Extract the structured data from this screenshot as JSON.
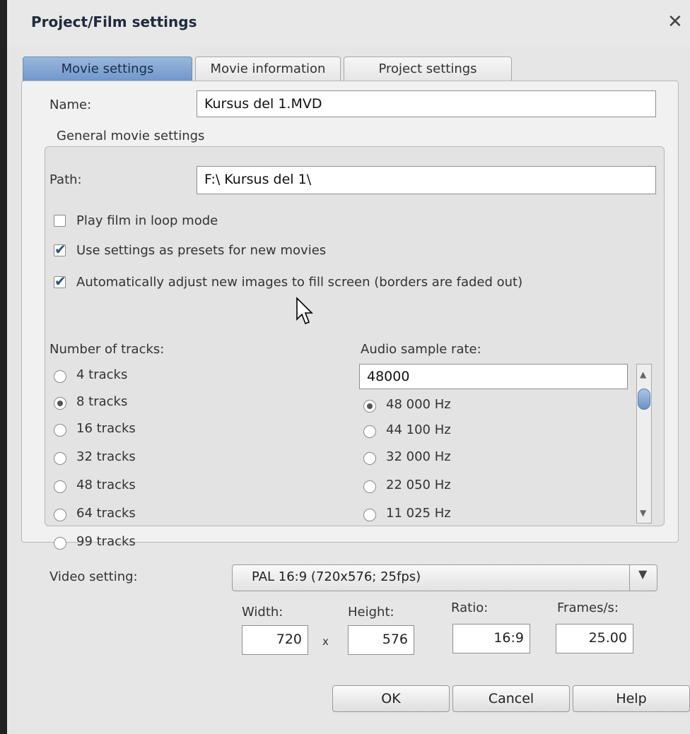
{
  "window": {
    "title": "Project/Film settings"
  },
  "tabs": [
    {
      "label": "Movie settings"
    },
    {
      "label": "Movie information"
    },
    {
      "label": "Project settings"
    }
  ],
  "name": {
    "label": "Name:",
    "value": "Kursus del 1.MVD"
  },
  "general": {
    "heading": "General movie settings",
    "path_label": "Path:",
    "path_value": "F:\\ Kursus del 1\\",
    "options": [
      {
        "label": "Play film in loop mode",
        "checked": false
      },
      {
        "label": "Use settings as presets for new movies",
        "checked": true
      },
      {
        "label": "Automatically adjust new images to fill screen (borders are faded out)",
        "checked": true
      }
    ]
  },
  "tracks": {
    "label": "Number of tracks:",
    "options": [
      "4 tracks",
      "8 tracks",
      "16 tracks",
      "32 tracks",
      "48 tracks",
      "64 tracks",
      "99 tracks"
    ],
    "selected": "8 tracks"
  },
  "audio": {
    "label": "Audio sample rate:",
    "value": "48000",
    "options": [
      "48 000 Hz",
      "44 100 Hz",
      "32 000 Hz",
      "22 050 Hz",
      "11 025 Hz"
    ],
    "selected": "48 000 Hz"
  },
  "video": {
    "label": "Video setting:",
    "selected": "PAL 16:9 (720x576; 25fps)",
    "width_label": "Width:",
    "height_label": "Height:",
    "ratio_label": "Ratio:",
    "fps_label": "Frames/s:",
    "width": "720",
    "times": "x",
    "height": "576",
    "ratio": "16:9",
    "fps": "25.00"
  },
  "buttons": {
    "ok": "OK",
    "cancel": "Cancel",
    "help": "Help"
  }
}
